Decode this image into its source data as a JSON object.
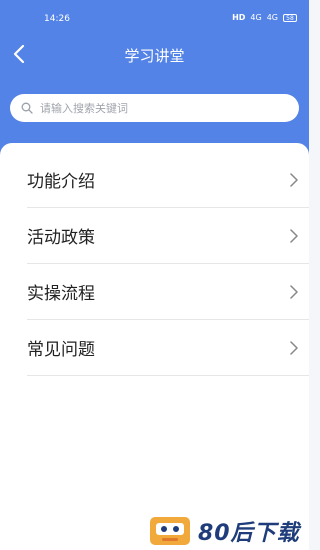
{
  "status_bar": {
    "time": "14:26",
    "hd": "HD",
    "signal_1": "4G",
    "signal_2": "4G",
    "battery": "58"
  },
  "nav": {
    "back_icon": "chevron-left-icon",
    "title": "学习讲堂"
  },
  "search": {
    "placeholder": "请输入搜索关键词",
    "icon": "search-icon"
  },
  "menu": {
    "items": [
      {
        "label": "功能介绍"
      },
      {
        "label": "活动政策"
      },
      {
        "label": "实操流程"
      },
      {
        "label": "常见问题"
      }
    ]
  },
  "watermark": {
    "text": "80后下载"
  },
  "colors": {
    "header": "#5383e6",
    "background": "#f5f6fa",
    "card": "#ffffff",
    "divider": "#e6e6e6",
    "text": "#222222",
    "chevron": "#888888"
  }
}
